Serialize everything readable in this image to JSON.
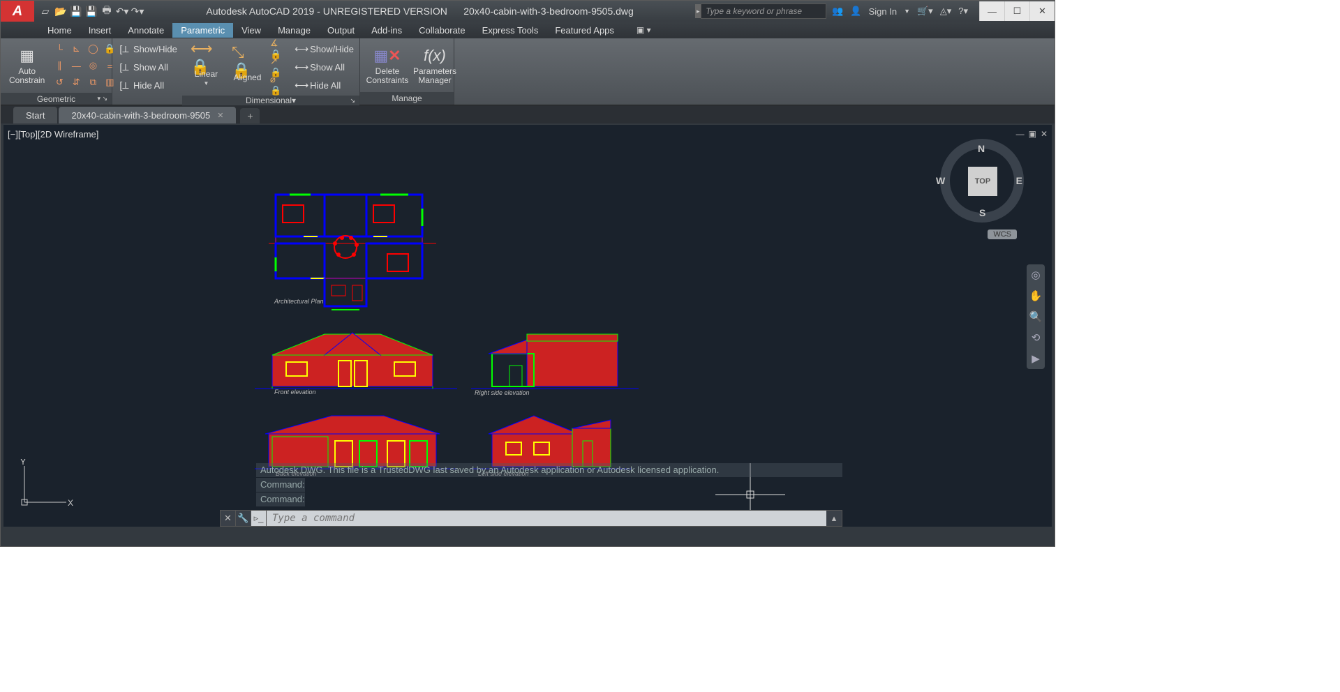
{
  "title_app": "Autodesk AutoCAD 2019 - UNREGISTERED VERSION",
  "title_file": "20x40-cabin-with-3-bedroom-9505.dwg",
  "search_placeholder": "Type a keyword or phrase",
  "signin": "Sign In",
  "menu": [
    "Home",
    "Insert",
    "Annotate",
    "Parametric",
    "View",
    "Manage",
    "Output",
    "Add-ins",
    "Collaborate",
    "Express Tools",
    "Featured Apps"
  ],
  "menu_active": 3,
  "ribbon": {
    "auto_constrain": "Auto\nConstrain",
    "geometric": "Geometric",
    "linear": "Linear",
    "aligned": "Aligned",
    "dimensional": "Dimensional",
    "showhide1": "Show/Hide",
    "showall1": "Show All",
    "hideall1": "Hide All",
    "showhide2": "Show/Hide",
    "showall2": "Show All",
    "hideall2": "Hide All",
    "delete_constraints": "Delete\nConstraints",
    "param_manager": "Parameters\nManager",
    "manage": "Manage"
  },
  "tabs": {
    "start": "Start",
    "file": "20x40-cabin-with-3-bedroom-9505"
  },
  "viewport_label": "[−][Top][2D Wireframe]",
  "viewcube": {
    "face": "TOP",
    "n": "N",
    "s": "S",
    "e": "E",
    "w": "W"
  },
  "wcs": "WCS",
  "drawing_labels": {
    "plan": "Architectural Plan",
    "front": "Front elevation",
    "right": "Right side elevation",
    "back": "Back elevation",
    "left": "Left side elevation"
  },
  "cmd_history": [
    "Autodesk DWG.  This file is a TrustedDWG last saved by an Autodesk application or Autodesk licensed application.",
    "Command:",
    "Command:"
  ],
  "cmd_placeholder": "Type a command"
}
